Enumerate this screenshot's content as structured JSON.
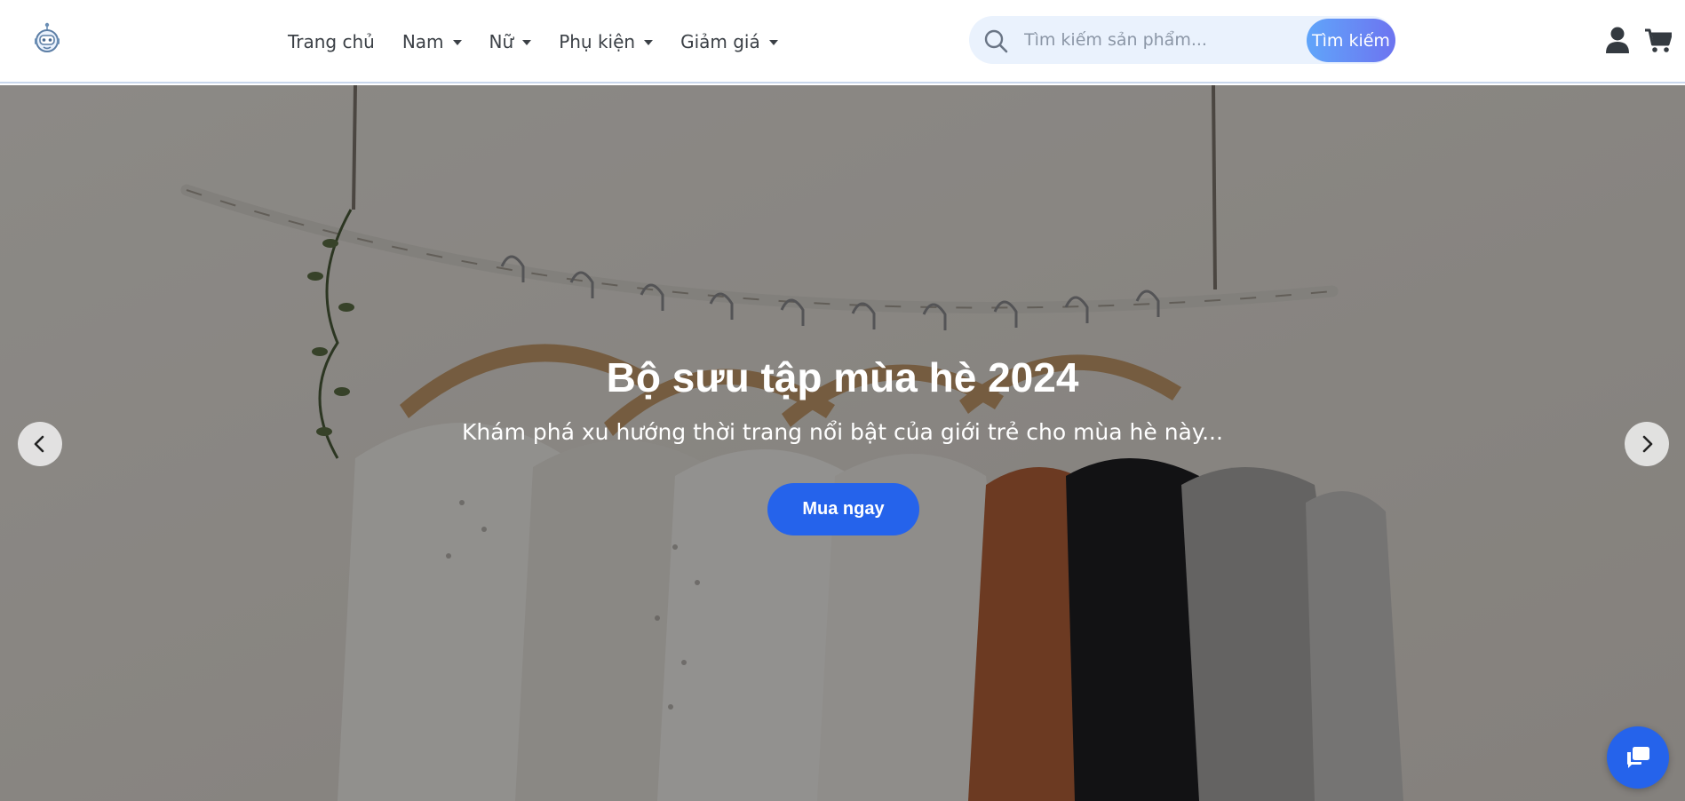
{
  "header": {
    "logo_icon": "robot-logo-icon",
    "nav": [
      {
        "label": "Trang chủ",
        "dropdown": false
      },
      {
        "label": "Nam",
        "dropdown": true
      },
      {
        "label": "Nữ",
        "dropdown": true
      },
      {
        "label": "Phụ kiện",
        "dropdown": true
      },
      {
        "label": "Giảm giá",
        "dropdown": true
      }
    ],
    "search": {
      "icon": "search-icon",
      "placeholder": "Tìm kiếm sản phẩm...",
      "value": "",
      "button_label": "Tìm kiếm"
    },
    "user_icon": "user-icon",
    "cart_icon": "cart-icon"
  },
  "hero": {
    "title": "Bộ sưu tập mùa hè 2024",
    "subtitle": "Khám phá xu hướng thời trang nổi bật của giới trẻ cho mùa hè này...",
    "cta_label": "Mua ngay",
    "prev_icon": "chevron-left-icon",
    "next_icon": "chevron-right-icon"
  },
  "chat": {
    "icon": "chat-icon"
  },
  "colors": {
    "primary": "#2563eb",
    "search_bg": "#eaf2fd",
    "search_button_gradient": [
      "#60a5fa",
      "#6d74f0"
    ],
    "nav_text": "#3b4046"
  }
}
